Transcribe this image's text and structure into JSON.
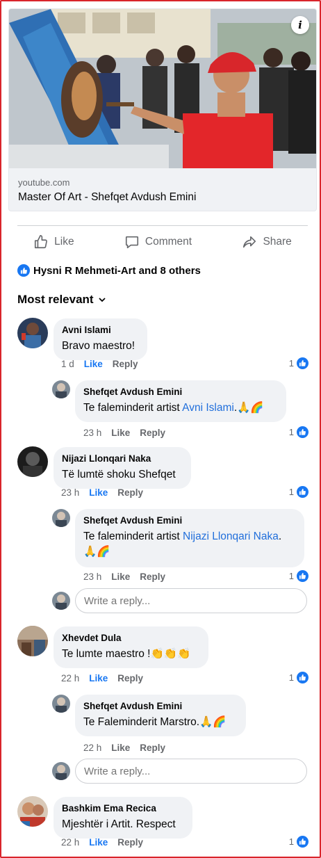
{
  "link_preview": {
    "domain": "youtube.com",
    "title": "Master Of Art - Shefqet Avdush Emini"
  },
  "actions": {
    "like": "Like",
    "comment": "Comment",
    "share": "Share"
  },
  "reactions": {
    "summary": "Hysni R Mehmeti-Art and 8 others"
  },
  "sort": {
    "label": "Most relevant"
  },
  "comments": [
    {
      "author": "Avni Islami",
      "text": "Bravo maestro!",
      "time": "1 d",
      "like": "Like",
      "reply": "Reply",
      "count": "1",
      "replies": [
        {
          "author": "Shefqet Avdush Emini",
          "text_before": "Te faleminderit artist ",
          "mention": "Avni Islami",
          "text_after": ".🙏🌈",
          "time": "23 h",
          "like": "Like",
          "reply": "Reply",
          "count": "1"
        }
      ]
    },
    {
      "author": "Nijazi Llonqari Naka",
      "text": "Të lumtë shoku Shefqet",
      "time": "23 h",
      "like": "Like",
      "reply": "Reply",
      "count": "1",
      "replies": [
        {
          "author": "Shefqet Avdush Emini",
          "text_before": "Te faleminderit artist ",
          "mention": "Nijazi Llonqari Naka",
          "text_after": ".",
          "text_line2": "🙏🌈",
          "time": "23 h",
          "like": "Like",
          "reply": "Reply",
          "count": "1"
        }
      ],
      "reply_placeholder": "Write a reply..."
    },
    {
      "author": "Xhevdet Dula",
      "text": "Te lumte maestro !👏👏👏",
      "time": "22 h",
      "like": "Like",
      "reply": "Reply",
      "count": "1",
      "replies": [
        {
          "author": "Shefqet Avdush Emini",
          "text": "Te Faleminderit Marstro.🙏🌈",
          "time": "22 h",
          "like": "Like",
          "reply": "Reply"
        }
      ],
      "reply_placeholder": "Write a reply..."
    },
    {
      "author": "Bashkim Ema Recica",
      "text": "Mjeshtër i Artit. Respect",
      "time": "22 h",
      "like": "Like",
      "reply": "Reply",
      "count": "1"
    }
  ],
  "colors": {
    "accent": "#1877f2",
    "mention": "#216fdb",
    "bubble": "#f0f2f5",
    "secondary_text": "#65676b",
    "frame": "#d9242b"
  }
}
